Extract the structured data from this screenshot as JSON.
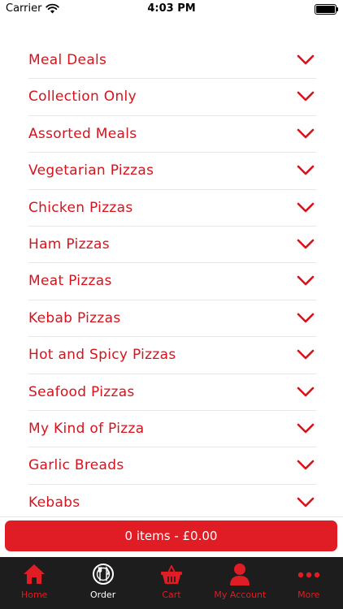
{
  "status_bar": {
    "carrier": "Carrier",
    "time": "4:03 PM"
  },
  "colors": {
    "accent": "#e01d24",
    "text_red": "#d9121c",
    "tab_bar": "#1d1d1d"
  },
  "menu": {
    "categories": [
      {
        "label": "Meal Deals",
        "icon": "chevron-down-icon"
      },
      {
        "label": "Collection Only",
        "icon": "chevron-down-icon"
      },
      {
        "label": "Assorted Meals",
        "icon": "chevron-down-icon"
      },
      {
        "label": "Vegetarian Pizzas",
        "icon": "chevron-down-icon"
      },
      {
        "label": "Chicken Pizzas",
        "icon": "chevron-down-icon"
      },
      {
        "label": "Ham Pizzas",
        "icon": "chevron-down-icon"
      },
      {
        "label": "Meat Pizzas",
        "icon": "chevron-down-icon"
      },
      {
        "label": "Kebab Pizzas",
        "icon": "chevron-down-icon"
      },
      {
        "label": "Hot and Spicy Pizzas",
        "icon": "chevron-down-icon"
      },
      {
        "label": "Seafood Pizzas",
        "icon": "chevron-down-icon"
      },
      {
        "label": "My Kind of Pizza",
        "icon": "chevron-down-icon"
      },
      {
        "label": "Garlic Breads",
        "icon": "chevron-down-icon"
      },
      {
        "label": "Kebabs",
        "icon": "chevron-down-icon"
      }
    ]
  },
  "cart": {
    "label": "0 items - £0.00"
  },
  "tab_bar": {
    "tabs": [
      {
        "label": "Home",
        "icon": "home-icon",
        "active": false
      },
      {
        "label": "Order",
        "icon": "plate-cutlery-icon",
        "active": true
      },
      {
        "label": "Cart",
        "icon": "basket-icon",
        "active": false
      },
      {
        "label": "My Account",
        "icon": "user-icon",
        "active": false
      },
      {
        "label": "More",
        "icon": "more-dots-icon",
        "active": false
      }
    ]
  }
}
